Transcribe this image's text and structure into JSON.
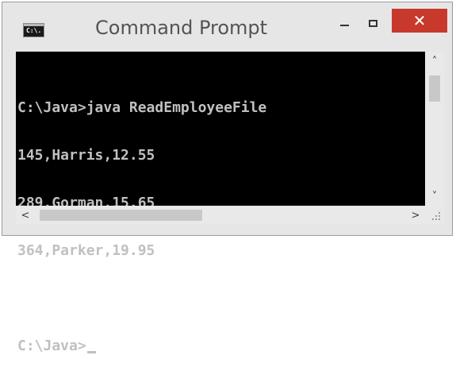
{
  "window": {
    "title": "Command Prompt",
    "icon": "cmd-icon",
    "icon_text": "C:\\.",
    "controls": {
      "minimize_icon": "minimize-icon",
      "maximize_icon": "maximize-icon",
      "close_label": "✕",
      "close_color": "#c7392b"
    }
  },
  "console": {
    "background": "#000000",
    "foreground": "#c0c0c0",
    "lines": [
      "C:\\Java>java ReadEmployeeFile",
      "145,Harris,12.55",
      "289,Gorman,15.65",
      "364,Parker,19.95",
      "",
      "C:\\Java>"
    ]
  },
  "scrollbars": {
    "up_arrow": "˄",
    "down_arrow": "˅",
    "left_arrow": "<",
    "right_arrow": ">"
  }
}
